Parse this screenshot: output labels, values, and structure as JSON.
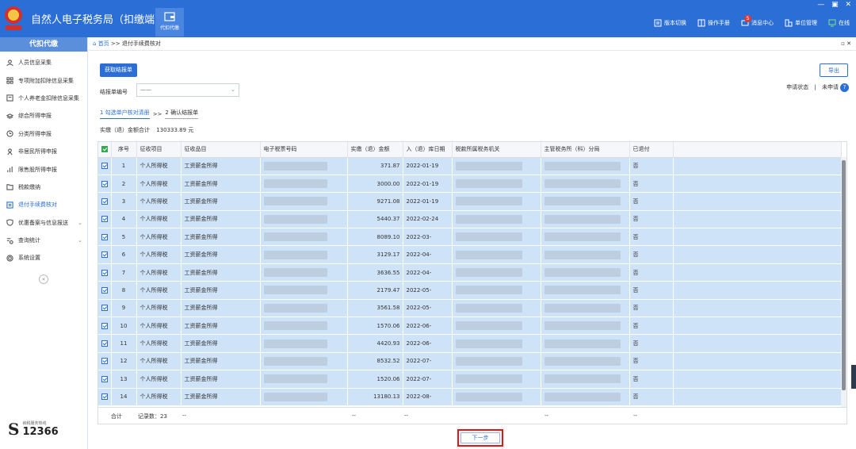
{
  "header": {
    "title": "自然人电子税务局（扣缴端）",
    "module_tab": "代扣代缴",
    "window_controls": [
      "—",
      "▣",
      "✕"
    ],
    "actions": [
      {
        "label": "版本切换",
        "icon": "switch-icon"
      },
      {
        "label": "操作手册",
        "icon": "book-icon"
      },
      {
        "label": "消息中心",
        "icon": "message-icon",
        "badge": "5"
      },
      {
        "label": "单位管理",
        "icon": "building-icon"
      },
      {
        "label": "在线",
        "icon": "monitor-icon"
      }
    ]
  },
  "sidebar": {
    "title": "代扣代缴",
    "items": [
      {
        "label": "人员信息采集",
        "icon": "user-icon"
      },
      {
        "label": "专项附加扣除信息采集",
        "icon": "grid-icon"
      },
      {
        "label": "个人养老金扣除信息采集",
        "icon": "form-icon"
      },
      {
        "label": "综合所得申报",
        "icon": "layers-icon"
      },
      {
        "label": "分类所得申报",
        "icon": "clock-icon"
      },
      {
        "label": "非居民所得申报",
        "icon": "person-outline-icon"
      },
      {
        "label": "限售股所得申报",
        "icon": "chart-icon"
      },
      {
        "label": "税款缴纳",
        "icon": "folder-icon"
      },
      {
        "label": "退付手续费核对",
        "icon": "document-icon",
        "active": true
      },
      {
        "label": "优惠备案与信息报送",
        "icon": "shield-icon",
        "expandable": true
      },
      {
        "label": "查询统计",
        "icon": "search-list-icon",
        "expandable": true
      },
      {
        "label": "系统设置",
        "icon": "gear-icon"
      }
    ],
    "collapse": "«",
    "hotline_caption": "纳税服务热线",
    "hotline_number": "12366"
  },
  "breadcrumb": {
    "home": "首页",
    "separator": ">>",
    "current": "退付手续费核对",
    "controls": "▫ ✕"
  },
  "toolbar": {
    "get_button": "获取结报单",
    "export_button": "导出",
    "status_label": "申请状态",
    "status_value": "未申请",
    "help": "?"
  },
  "form": {
    "label": "结报单编号",
    "select_value": "——"
  },
  "steps": {
    "step1": "1 勾选单户核对清册",
    "separator": ">>",
    "step2": "2 确认结报单"
  },
  "summary": {
    "label": "实缴（退）金额合计",
    "value": "130333.89 元"
  },
  "table": {
    "columns": [
      "序号",
      "征收项目",
      "征收品目",
      "电子税票号码",
      "实缴（退）金额",
      "入（退）库日期",
      "税款所属税务机关",
      "主管税务所（科）分局",
      "已退付"
    ],
    "rows": [
      {
        "no": "1",
        "item": "个人所得税",
        "sub": "工资薪金所得",
        "amount": "371.87",
        "date": "2022-01-19",
        "refunded": "否"
      },
      {
        "no": "2",
        "item": "个人所得税",
        "sub": "工资薪金所得",
        "amount": "3000.00",
        "date": "2022-01-19",
        "refunded": "否"
      },
      {
        "no": "3",
        "item": "个人所得税",
        "sub": "工资薪金所得",
        "amount": "9271.08",
        "date": "2022-01-19",
        "refunded": "否"
      },
      {
        "no": "4",
        "item": "个人所得税",
        "sub": "工资薪金所得",
        "amount": "5440.37",
        "date": "2022-02-24",
        "refunded": "否"
      },
      {
        "no": "5",
        "item": "个人所得税",
        "sub": "工资薪金所得",
        "amount": "8089.10",
        "date": "2022-03-",
        "refunded": "否"
      },
      {
        "no": "6",
        "item": "个人所得税",
        "sub": "工资薪金所得",
        "amount": "3129.17",
        "date": "2022-04-",
        "refunded": "否"
      },
      {
        "no": "7",
        "item": "个人所得税",
        "sub": "工资薪金所得",
        "amount": "3636.55",
        "date": "2022-04-",
        "refunded": "否"
      },
      {
        "no": "8",
        "item": "个人所得税",
        "sub": "工资薪金所得",
        "amount": "2179.47",
        "date": "2022-05-",
        "refunded": "否"
      },
      {
        "no": "9",
        "item": "个人所得税",
        "sub": "工资薪金所得",
        "amount": "3561.58",
        "date": "2022-05-",
        "refunded": "否"
      },
      {
        "no": "10",
        "item": "个人所得税",
        "sub": "工资薪金所得",
        "amount": "1570.06",
        "date": "2022-06-",
        "refunded": "否"
      },
      {
        "no": "11",
        "item": "个人所得税",
        "sub": "工资薪金所得",
        "amount": "4420.93",
        "date": "2022-06-",
        "refunded": "否"
      },
      {
        "no": "12",
        "item": "个人所得税",
        "sub": "工资薪金所得",
        "amount": "8532.52",
        "date": "2022-07-",
        "refunded": "否"
      },
      {
        "no": "13",
        "item": "个人所得税",
        "sub": "工资薪金所得",
        "amount": "1520.06",
        "date": "2022-07-",
        "refunded": "否"
      },
      {
        "no": "14",
        "item": "个人所得税",
        "sub": "工资薪金所得",
        "amount": "13180.13",
        "date": "2022-08-",
        "refunded": "否"
      }
    ],
    "footer": {
      "label": "合计",
      "count": "记录数：23",
      "dash": "--"
    }
  },
  "next_button": "下一步",
  "colors": {
    "primary": "#2b6fd6",
    "row_selected": "#cfe3f8",
    "highlight": "#e11111"
  }
}
